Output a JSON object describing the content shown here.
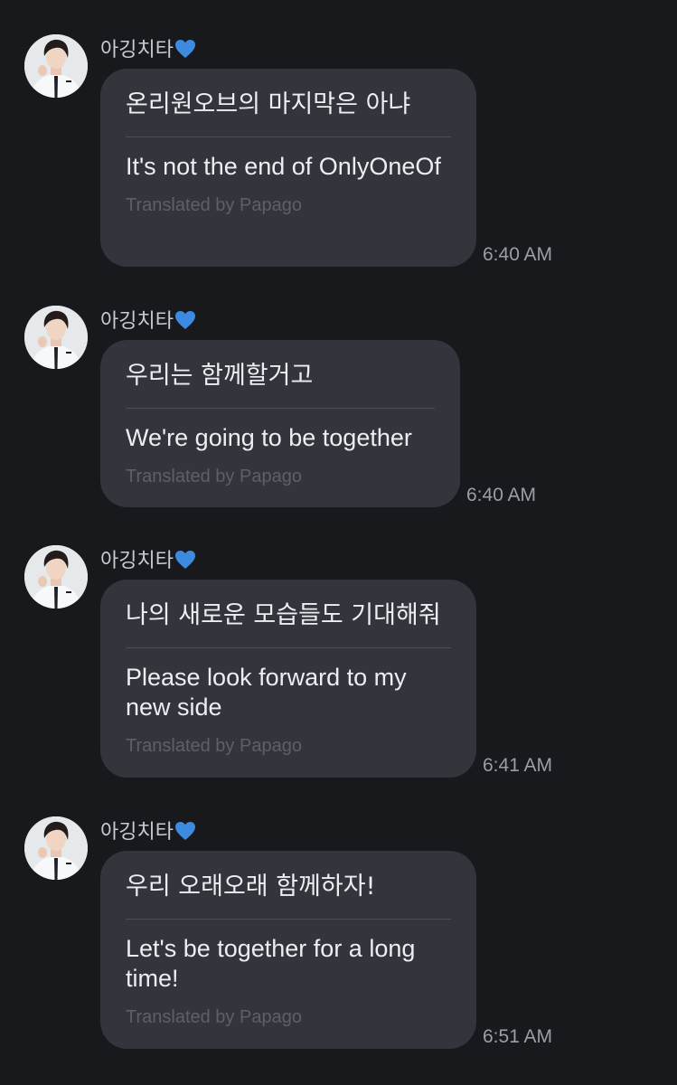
{
  "messages": [
    {
      "sender": "아깅치타",
      "original": "온리원오브의 마지막은 아냐",
      "translation": "It's not the end of OnlyOneOf",
      "credit": "Translated by Papago",
      "time": "6:40 AM"
    },
    {
      "sender": "아깅치타",
      "original": "우리는 함께할거고",
      "translation": "We're going to be together",
      "credit": "Translated by Papago",
      "time": "6:40 AM"
    },
    {
      "sender": "아깅치타",
      "original": "나의 새로운 모습들도 기대해줘",
      "translation": "Please look forward to my new side",
      "credit": "Translated by Papago",
      "time": "6:41 AM"
    },
    {
      "sender": "아깅치타",
      "original": "우리 오래오래 함께하자!",
      "translation": "Let's be together for a long time!",
      "credit": "Translated by Papago",
      "time": "6:51 AM"
    }
  ],
  "icons": {
    "heart": "blue-heart-icon",
    "heart_color": "#3d8be0"
  }
}
